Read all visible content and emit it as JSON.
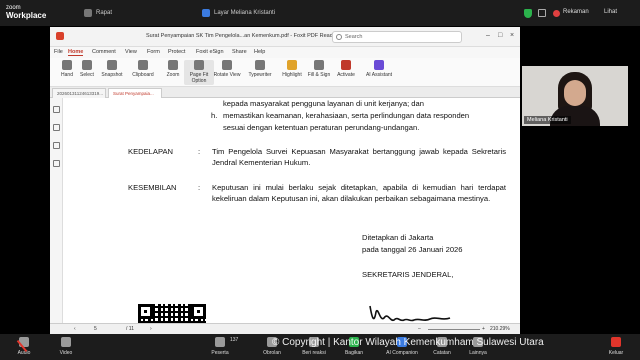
{
  "zoom": {
    "logo_line1": "zoom",
    "logo_line2": "Workplace",
    "top_items": [
      {
        "label": "Rapat",
        "icon": "home-icon"
      },
      {
        "label": "Layar Meliana Kristanti",
        "icon": "screen-share-icon"
      }
    ],
    "host_label": "Rekaman",
    "view_label": "Lihat",
    "participant_count": "137",
    "toolbar": [
      {
        "label": "Audio",
        "icon": "microphone-muted-icon"
      },
      {
        "label": "Video",
        "icon": "video-camera-icon"
      },
      {
        "label": "Peserta",
        "icon": "participants-icon"
      },
      {
        "label": "Obrolan",
        "icon": "chat-icon"
      },
      {
        "label": "Beri reaksi",
        "icon": "reaction-icon"
      },
      {
        "label": "Bagikan",
        "icon": "share-icon"
      },
      {
        "label": "AI Companion",
        "icon": "ai-companion-icon"
      },
      {
        "label": "Catatan",
        "icon": "notes-icon"
      },
      {
        "label": "Lainnya",
        "icon": "more-icon"
      },
      {
        "label": "Keluar",
        "icon": "leave-icon"
      }
    ],
    "watermark": "© Copyright | Kantor Wilayah Kemenkumham Sulawesi Utara"
  },
  "reader": {
    "doc_title": "Surat Penyampaian SK Tim Pengelola...an Kemenkum.pdf - Foxit PDF Reader",
    "search_placeholder": "Search",
    "menu": [
      "File",
      "Home",
      "Comment",
      "View",
      "Form",
      "Protect",
      "Foxit eSign",
      "Share",
      "Help"
    ],
    "ribbon": [
      {
        "label": "Hand",
        "icon": "hand-icon"
      },
      {
        "label": "Select",
        "icon": "select-icon"
      },
      {
        "label": "Snapshot",
        "icon": "snapshot-icon"
      },
      {
        "label": "Clipboard",
        "icon": "clipboard-icon"
      },
      {
        "label": "Zoom",
        "icon": "zoom-icon"
      },
      {
        "label": "Page Fit Option",
        "icon": "page-fit-icon"
      },
      {
        "label": "Rotate View",
        "icon": "rotate-icon"
      },
      {
        "label": "Typewriter",
        "icon": "typewriter-icon"
      },
      {
        "label": "Highlight",
        "icon": "highlight-icon"
      },
      {
        "label": "Fill & Sign",
        "icon": "fill-sign-icon"
      },
      {
        "label": "Activate",
        "icon": "activate-icon"
      },
      {
        "label": "AI Assistant",
        "icon": "ai-assistant-icon"
      }
    ],
    "tabs": [
      "20260131124613319...",
      "Surat Penyampaia..."
    ],
    "page_current": "5",
    "page_total": "/ 11",
    "zoom_level": "210.29%"
  },
  "document": {
    "line_top": "kepada masyarakat pengguna layanan di unit kerjanya; dan",
    "item_h_marker": "h.",
    "item_h_text1": "memastikan keamanan, kerahasiaan, serta perlindungan data responden",
    "item_h_text2": "sesuai dengan ketentuan peraturan perundang-undangan.",
    "kedelapan_label": "KEDELAPAN",
    "colon": ":",
    "kedelapan_text": "Tim Pengelola Survei Kepuasan Masyarakat bertanggung jawab kepada Sekretaris Jendral Kementerian Hukum.",
    "kesembilan_label": "KESEMBILAN",
    "kesembilan_text": "Keputusan ini mulai berlaku sejak ditetapkan, apabila di kemudian hari terdapat kekeliruan dalam Keputusan ini, akan dilakukan perbaikan sebagaimana mestinya.",
    "ditetapkan": "Ditetapkan di Jakarta",
    "tanggal": "pada tanggal 26 Januari 2026",
    "jabatan": "SEKRETARIS JENDERAL,"
  },
  "participant": {
    "name": "Meliana Kristanti"
  }
}
